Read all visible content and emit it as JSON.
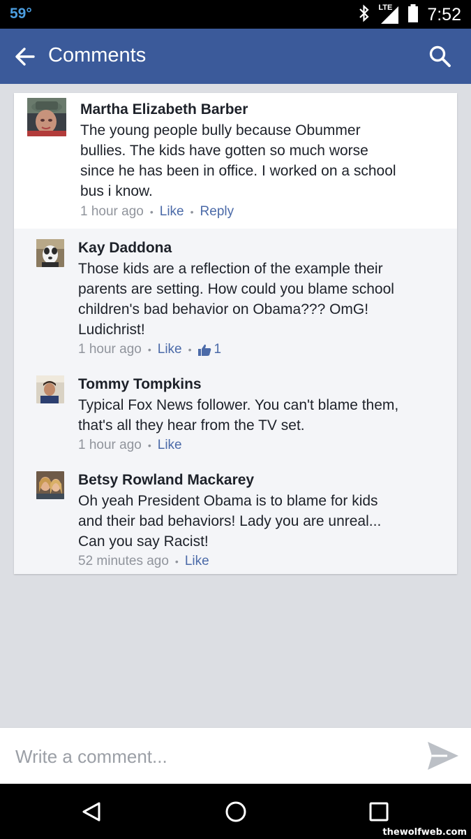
{
  "status_bar": {
    "temperature": "59°",
    "network": "LTE",
    "time": "7:52"
  },
  "app_bar": {
    "title": "Comments",
    "back_icon": "arrow-left-icon",
    "search_icon": "search-icon"
  },
  "comments": [
    {
      "author": "Martha Elizabeth Barber",
      "lines": [
        "The young people bully because Obummer",
        "bullies. The kids have gotten so much worse",
        "since he has been in office. I worked on a school",
        "bus i know."
      ],
      "time": "1 hour ago",
      "like": "Like",
      "reply": "Reply"
    },
    {
      "author": "Kay Daddona",
      "lines": [
        "Those kids are a reflection of the example their",
        "parents are setting. How could you blame school",
        "children's bad behavior on Obama???  OmG!",
        "Ludichrist!"
      ],
      "time": "1 hour ago",
      "like": "Like",
      "like_count": "1"
    },
    {
      "author": "Tommy Tompkins",
      "lines": [
        "Typical Fox News follower. You can't blame them,",
        "that's all they hear from the TV set."
      ],
      "time": "1 hour ago",
      "like": "Like"
    },
    {
      "author": "Betsy Rowland Mackarey",
      "lines": [
        "Oh yeah President Obama is to blame for kids",
        "and their bad behaviors!  Lady you are unreal...",
        "Can you say Racist!"
      ],
      "time": "52 minutes ago",
      "like": "Like"
    }
  ],
  "composer": {
    "placeholder": "Write a comment..."
  },
  "nav_bar": {
    "back_icon": "triangle-back-icon",
    "home_icon": "circle-home-icon",
    "recents_icon": "square-recents-icon"
  },
  "watermark": "thewolfweb.com",
  "colors": {
    "app_bar": "#3b5a9a",
    "link": "#4b6aa8",
    "meta": "#90949c",
    "background": "#dcdee3"
  }
}
